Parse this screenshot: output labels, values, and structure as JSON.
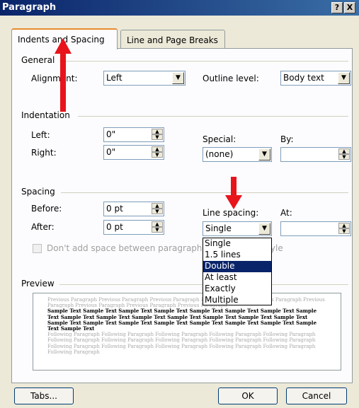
{
  "window": {
    "title": "Paragraph",
    "help_button": "?",
    "close_button": "X"
  },
  "tabs": [
    {
      "label": "Indents and Spacing"
    },
    {
      "label": "Line and Page Breaks"
    }
  ],
  "general": {
    "legend": "General",
    "alignment_label": "Alignment:",
    "alignment_value": "Left",
    "outline_label": "Outline level:",
    "outline_value": "Body text"
  },
  "indentation": {
    "legend": "Indentation",
    "left_label": "Left:",
    "left_value": "0\"",
    "right_label": "Right:",
    "right_value": "0\"",
    "special_label": "Special:",
    "special_value": "(none)",
    "by_label": "By:",
    "by_value": ""
  },
  "spacing": {
    "legend": "Spacing",
    "before_label": "Before:",
    "before_value": "0 pt",
    "after_label": "After:",
    "after_value": "0 pt",
    "line_spacing_label": "Line spacing:",
    "line_spacing_value": "Single",
    "at_label": "At:",
    "at_value": "",
    "dont_add_label": "Don't add space between paragraphs of the same style",
    "line_spacing_options": [
      "Single",
      "1.5 lines",
      "Double",
      "At least",
      "Exactly",
      "Multiple"
    ],
    "highlighted_option": "Double"
  },
  "preview": {
    "legend": "Preview",
    "previous_text": "Previous Paragraph Previous Paragraph Previous Paragraph Previous Paragraph Previous Paragraph Previous Paragraph Previous Paragraph Previous Paragraph Previous Paragraph",
    "sample_text": "Sample Text Sample Text Sample Text Sample Text Sample Text Sample Text Sample Text Sample Text Sample Text Sample Text Sample Text Sample Text Sample Text Sample Text Sample Text Sample Text Sample Text Sample Text Sample Text Sample Text Sample Text Sample Text Sample Text Sample Text",
    "following_text": "Following Paragraph Following Paragraph Following Paragraph Following Paragraph Following Paragraph Following Paragraph Following Paragraph Following Paragraph Following Paragraph Following Paragraph Following Paragraph Following Paragraph Following Paragraph Following Paragraph Following Paragraph Following Paragraph"
  },
  "buttons": {
    "tabs": "Tabs...",
    "ok": "OK",
    "cancel": "Cancel"
  },
  "annotations": {
    "arrow_color": "#e8141b"
  }
}
